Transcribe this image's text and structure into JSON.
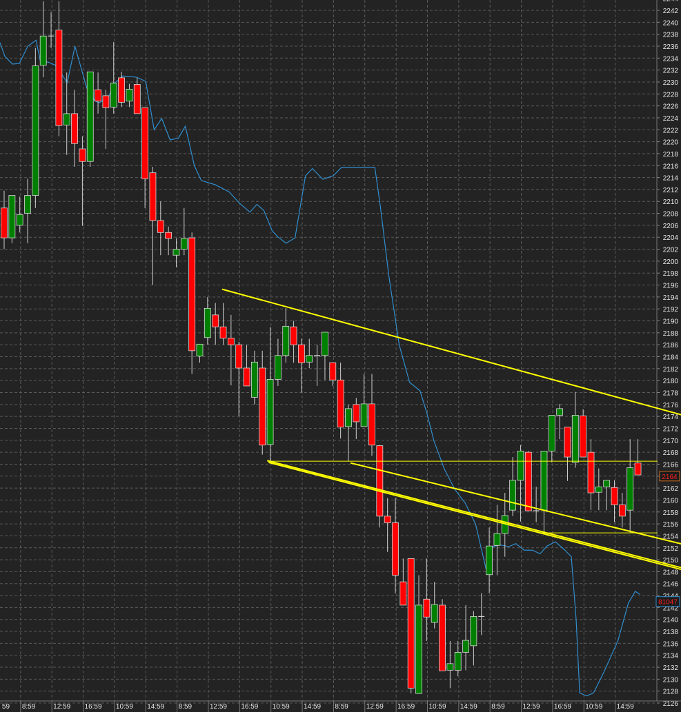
{
  "chart_data": {
    "type": "candlestick",
    "title": "",
    "y_axis": {
      "min": 2126,
      "max": 2244,
      "step": 2,
      "side": "right"
    },
    "x_axis": {
      "leading_label": "59",
      "labels": [
        "8:59",
        "12:59",
        "16:59",
        "10:59",
        "14:59",
        "8:59",
        "12:59",
        "16:59",
        "10:59",
        "14:59",
        "8:59",
        "12:59",
        "16:59",
        "10:59",
        "14:59",
        "8:59",
        "12:59",
        "16:59",
        "10:59",
        "14:59"
      ],
      "candles_per_label": 4
    },
    "grid": true,
    "colors": {
      "background": "#232323",
      "up": "#008000",
      "down": "#ff0000",
      "candle_border": "#d8d8d8",
      "wick": "#cfcfcf",
      "grid": "#5a5a5a",
      "indicator": "#2f8fd0",
      "trendline": "#ffff00"
    },
    "candles_ohlc": [
      [
        2208.9,
        2211.8,
        2202.0,
        2203.9
      ],
      [
        2203.9,
        2211.0,
        2203.0,
        2211.0
      ],
      [
        2206.0,
        2210.8,
        2204.8,
        2207.8
      ],
      [
        2208.0,
        2213.8,
        2203.0,
        2211.0
      ],
      [
        2211.0,
        2235.7,
        2208.9,
        2232.7
      ],
      [
        2232.8,
        2243.5,
        2230.8,
        2237.7
      ],
      [
        2237.7,
        2241.7,
        2235.7,
        2237.7
      ],
      [
        2238.7,
        2243.5,
        2220.9,
        2222.7
      ],
      [
        2222.8,
        2231.6,
        2217.8,
        2224.7
      ],
      [
        2224.7,
        2228.7,
        2215.8,
        2219.7
      ],
      [
        2218.8,
        2220.9,
        2205.9,
        2216.7
      ],
      [
        2216.7,
        2231.7,
        2215.8,
        2231.7
      ],
      [
        2228.7,
        2231.6,
        2224.7,
        2226.8
      ],
      [
        2227.7,
        2228.7,
        2218.8,
        2225.7
      ],
      [
        2225.8,
        2236.7,
        2224.7,
        2229.8
      ],
      [
        2230.7,
        2231.7,
        2225.8,
        2226.6
      ],
      [
        2226.8,
        2229.7,
        2225.8,
        2228.8
      ],
      [
        2229.6,
        2230.7,
        2224.7,
        2224.7
      ],
      [
        2225.7,
        2225.7,
        2208.9,
        2213.8
      ],
      [
        2214.8,
        2215.8,
        2196.0,
        2206.8
      ],
      [
        2206.8,
        2210.0,
        2201.0,
        2204.8
      ],
      [
        2204.8,
        2205.8,
        2201.0,
        2203.8
      ],
      [
        2201.0,
        2203.8,
        2199.0,
        2202.0
      ],
      [
        2202.0,
        2208.9,
        2201.0,
        2203.8
      ],
      [
        2203.9,
        2204.8,
        2181.1,
        2185.0
      ],
      [
        2184.1,
        2186.1,
        2183.0,
        2186.1
      ],
      [
        2187.2,
        2194.0,
        2186.0,
        2192.1
      ],
      [
        2191.0,
        2193.0,
        2186.0,
        2189.0
      ],
      [
        2189.0,
        2193.0,
        2186.0,
        2187.1
      ],
      [
        2187.1,
        2191.0,
        2179.2,
        2186.0
      ],
      [
        2186.0,
        2186.5,
        2174.1,
        2182.1
      ],
      [
        2182.1,
        2186.0,
        2179.1,
        2179.1
      ],
      [
        2177.2,
        2185.0,
        2176.0,
        2183.1
      ],
      [
        2182.1,
        2185.0,
        2167.6,
        2169.2
      ],
      [
        2169.3,
        2189.0,
        2166.4,
        2180.2
      ],
      [
        2180.2,
        2187.0,
        2179.1,
        2184.2
      ],
      [
        2184.2,
        2192.1,
        2183.0,
        2189.1
      ],
      [
        2189.0,
        2190.0,
        2183.0,
        2186.0
      ],
      [
        2186.0,
        2187.0,
        2178.0,
        2183.0
      ],
      [
        2183.1,
        2187.0,
        2182.1,
        2184.2
      ],
      [
        2184.2,
        2186.0,
        2179.1,
        2184.2
      ],
      [
        2184.2,
        2188.1,
        2180.1,
        2188.1
      ],
      [
        2183.0,
        2183.0,
        2179.1,
        2180.1
      ],
      [
        2180.1,
        2183.0,
        2170.3,
        2172.2
      ],
      [
        2172.3,
        2176.0,
        2166.5,
        2175.3
      ],
      [
        2176.0,
        2177.1,
        2170.2,
        2173.1
      ],
      [
        2172.3,
        2181.1,
        2172.3,
        2176.1
      ],
      [
        2176.1,
        2181.1,
        2167.4,
        2169.2
      ],
      [
        2169.1,
        2169.2,
        2155.4,
        2157.3
      ],
      [
        2157.3,
        2160.3,
        2151.3,
        2156.2
      ],
      [
        2156.2,
        2160.3,
        2144.4,
        2147.4
      ],
      [
        2146.3,
        2150.2,
        2142.4,
        2142.4
      ],
      [
        2150.2,
        2150.2,
        2127.6,
        2128.5
      ],
      [
        2127.6,
        2147.4,
        2127.6,
        2142.4
      ],
      [
        2143.4,
        2150.2,
        2136.4,
        2140.4
      ],
      [
        2139.5,
        2146.3,
        2138.5,
        2142.5
      ],
      [
        2142.4,
        2143.4,
        2131.4,
        2131.4
      ],
      [
        2131.5,
        2136.4,
        2128.5,
        2132.6
      ],
      [
        2131.5,
        2136.4,
        2130.5,
        2134.5
      ],
      [
        2134.5,
        2142.4,
        2131.5,
        2136.5
      ],
      [
        2135.6,
        2141.4,
        2132.3,
        2140.5
      ],
      [
        2140.5,
        2144.4,
        2137.4,
        2140.5
      ],
      [
        2147.5,
        2155.4,
        2144.4,
        2152.3
      ],
      [
        2152.4,
        2159.2,
        2147.4,
        2154.4
      ],
      [
        2154.4,
        2161.2,
        2150.5,
        2157.4
      ],
      [
        2158.3,
        2167.2,
        2157.3,
        2163.3
      ],
      [
        2163.3,
        2169.2,
        2156.4,
        2168.2
      ],
      [
        2168.0,
        2168.2,
        2158.2,
        2158.2
      ],
      [
        2158.2,
        2162.2,
        2156.3,
        2158.2
      ],
      [
        2158.3,
        2168.2,
        2154.5,
        2168.2
      ],
      [
        2168.2,
        2174.2,
        2166.3,
        2174.2
      ],
      [
        2174.2,
        2176.1,
        2170.2,
        2175.3
      ],
      [
        2172.2,
        2172.2,
        2163.2,
        2167.2
      ],
      [
        2166.3,
        2178.1,
        2165.4,
        2174.2
      ],
      [
        2174.1,
        2175.2,
        2167.2,
        2167.2
      ],
      [
        2168.0,
        2170.2,
        2158.3,
        2161.2
      ],
      [
        2161.3,
        2165.3,
        2158.3,
        2162.2
      ],
      [
        2162.2,
        2163.3,
        2158.3,
        2163.3
      ],
      [
        2162.1,
        2163.3,
        2156.3,
        2159.2
      ],
      [
        2159.2,
        2161.2,
        2155.4,
        2157.3
      ],
      [
        2158.3,
        2170.2,
        2154.5,
        2165.4
      ],
      [
        2166.2,
        2170.2,
        2164.2,
        2164.2
      ]
    ],
    "indicator_line": [
      [
        -0.53,
        2236.6
      ],
      [
        0.09,
        2234.3
      ],
      [
        1.06,
        2233.0
      ],
      [
        1.95,
        2233.1
      ],
      [
        3.02,
        2236.0
      ],
      [
        4.08,
        2237.0
      ],
      [
        4.61,
        2233.6
      ],
      [
        5.68,
        2233.3
      ],
      [
        6.57,
        2232.8
      ],
      [
        8.07,
        2229.9
      ],
      [
        9.05,
        2236.0
      ],
      [
        10.56,
        2229.0
      ],
      [
        11.62,
        2226.8
      ],
      [
        12.16,
        2226.5
      ],
      [
        13.4,
        2227.6
      ],
      [
        13.93,
        2229.6
      ],
      [
        15.17,
        2231.0
      ],
      [
        16.95,
        2230.8
      ],
      [
        18.1,
        2230.1
      ],
      [
        19.17,
        2222.0
      ],
      [
        20.14,
        2223.9
      ],
      [
        21.21,
        2220.3
      ],
      [
        22.27,
        2220.6
      ],
      [
        23.16,
        2222.6
      ],
      [
        24.31,
        2216.0
      ],
      [
        25.2,
        2213.5
      ],
      [
        26.97,
        2212.8
      ],
      [
        28.75,
        2211.6
      ],
      [
        30.08,
        2209.7
      ],
      [
        31.41,
        2208.2
      ],
      [
        32.3,
        2209.5
      ],
      [
        33.19,
        2208.5
      ],
      [
        34.25,
        2205.1
      ],
      [
        34.96,
        2204.1
      ],
      [
        36.03,
        2203.0
      ],
      [
        37.18,
        2203.9
      ],
      [
        38.51,
        2214.3
      ],
      [
        39.4,
        2215.5
      ],
      [
        40.73,
        2213.7
      ],
      [
        42.06,
        2214.3
      ],
      [
        43.12,
        2215.7
      ],
      [
        47.38,
        2215.7
      ],
      [
        48.09,
        2209.1
      ],
      [
        49.16,
        2197.6
      ],
      [
        50.49,
        2186.0
      ],
      [
        51.82,
        2179.7
      ],
      [
        53.15,
        2178.3
      ],
      [
        54.04,
        2174.5
      ],
      [
        54.93,
        2169.9
      ],
      [
        56.26,
        2165.2
      ],
      [
        57.59,
        2161.8
      ],
      [
        58.92,
        2159.5
      ],
      [
        60.25,
        2156.0
      ],
      [
        61.58,
        2148.5
      ],
      [
        62.47,
        2152.2
      ],
      [
        63.35,
        2152.5
      ],
      [
        64.51,
        2152.2
      ],
      [
        65.4,
        2152.7
      ],
      [
        66.46,
        2151.6
      ],
      [
        67.52,
        2151.6
      ],
      [
        68.5,
        2151.0
      ],
      [
        69.39,
        2152.3
      ],
      [
        70.45,
        2153.0
      ],
      [
        71.6,
        2151.7
      ],
      [
        72.49,
        2150.5
      ],
      [
        73.11,
        2139.9
      ],
      [
        73.56,
        2127.7
      ],
      [
        74.45,
        2127.2
      ],
      [
        75.33,
        2127.7
      ],
      [
        76.66,
        2131.2
      ],
      [
        78.44,
        2136.4
      ],
      [
        79.77,
        2142.7
      ],
      [
        80.66,
        2144.7
      ],
      [
        81.28,
        2144.2
      ]
    ],
    "trendlines": [
      {
        "name": "upper-channel",
        "from": [
          27.86,
          2195.3
        ],
        "to": [
          87.04,
          2174.1
        ],
        "thick": true
      },
      {
        "name": "lower-channel-a",
        "from": [
          33.63,
          2166.6
        ],
        "to": [
          87.04,
          2148.5
        ],
        "thick": true
      },
      {
        "name": "lower-channel-b",
        "from": [
          33.8,
          2166.3
        ],
        "to": [
          87.04,
          2148.2
        ],
        "thick": true
      },
      {
        "name": "mid-channel",
        "from": [
          44.28,
          2166.2
        ],
        "to": [
          87.04,
          2152.5
        ],
        "thick": true
      },
      {
        "name": "horizontal-2166",
        "from": [
          33.63,
          2166.5
        ],
        "to": [
          83.5,
          2166.5
        ],
        "thick": false
      },
      {
        "name": "horizontal-2154",
        "from": [
          68.3,
          2154.5
        ],
        "to": [
          83.5,
          2154.5
        ],
        "thick": false
      }
    ],
    "last_price_label": "2164",
    "last_price_value": 2164,
    "indicator_label": "81047",
    "indicator_label_value": 2143
  }
}
